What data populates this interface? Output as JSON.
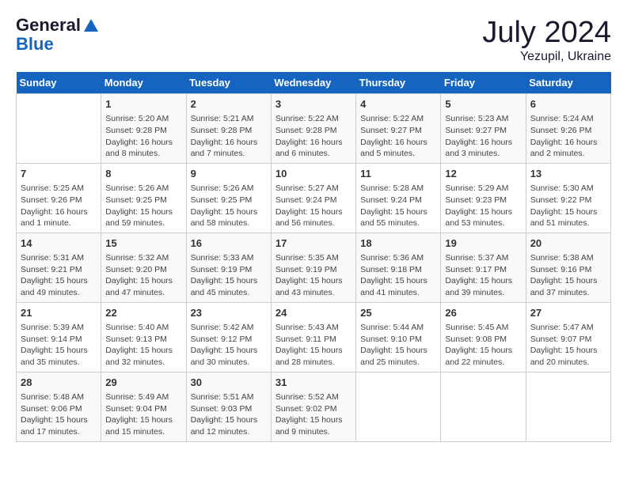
{
  "header": {
    "logo_line1": "General",
    "logo_line2": "Blue",
    "month": "July 2024",
    "location": "Yezupil, Ukraine"
  },
  "weekdays": [
    "Sunday",
    "Monday",
    "Tuesday",
    "Wednesday",
    "Thursday",
    "Friday",
    "Saturday"
  ],
  "weeks": [
    [
      {
        "day": "",
        "info": ""
      },
      {
        "day": "1",
        "info": "Sunrise: 5:20 AM\nSunset: 9:28 PM\nDaylight: 16 hours\nand 8 minutes."
      },
      {
        "day": "2",
        "info": "Sunrise: 5:21 AM\nSunset: 9:28 PM\nDaylight: 16 hours\nand 7 minutes."
      },
      {
        "day": "3",
        "info": "Sunrise: 5:22 AM\nSunset: 9:28 PM\nDaylight: 16 hours\nand 6 minutes."
      },
      {
        "day": "4",
        "info": "Sunrise: 5:22 AM\nSunset: 9:27 PM\nDaylight: 16 hours\nand 5 minutes."
      },
      {
        "day": "5",
        "info": "Sunrise: 5:23 AM\nSunset: 9:27 PM\nDaylight: 16 hours\nand 3 minutes."
      },
      {
        "day": "6",
        "info": "Sunrise: 5:24 AM\nSunset: 9:26 PM\nDaylight: 16 hours\nand 2 minutes."
      }
    ],
    [
      {
        "day": "7",
        "info": "Sunrise: 5:25 AM\nSunset: 9:26 PM\nDaylight: 16 hours\nand 1 minute."
      },
      {
        "day": "8",
        "info": "Sunrise: 5:26 AM\nSunset: 9:25 PM\nDaylight: 15 hours\nand 59 minutes."
      },
      {
        "day": "9",
        "info": "Sunrise: 5:26 AM\nSunset: 9:25 PM\nDaylight: 15 hours\nand 58 minutes."
      },
      {
        "day": "10",
        "info": "Sunrise: 5:27 AM\nSunset: 9:24 PM\nDaylight: 15 hours\nand 56 minutes."
      },
      {
        "day": "11",
        "info": "Sunrise: 5:28 AM\nSunset: 9:24 PM\nDaylight: 15 hours\nand 55 minutes."
      },
      {
        "day": "12",
        "info": "Sunrise: 5:29 AM\nSunset: 9:23 PM\nDaylight: 15 hours\nand 53 minutes."
      },
      {
        "day": "13",
        "info": "Sunrise: 5:30 AM\nSunset: 9:22 PM\nDaylight: 15 hours\nand 51 minutes."
      }
    ],
    [
      {
        "day": "14",
        "info": "Sunrise: 5:31 AM\nSunset: 9:21 PM\nDaylight: 15 hours\nand 49 minutes."
      },
      {
        "day": "15",
        "info": "Sunrise: 5:32 AM\nSunset: 9:20 PM\nDaylight: 15 hours\nand 47 minutes."
      },
      {
        "day": "16",
        "info": "Sunrise: 5:33 AM\nSunset: 9:19 PM\nDaylight: 15 hours\nand 45 minutes."
      },
      {
        "day": "17",
        "info": "Sunrise: 5:35 AM\nSunset: 9:19 PM\nDaylight: 15 hours\nand 43 minutes."
      },
      {
        "day": "18",
        "info": "Sunrise: 5:36 AM\nSunset: 9:18 PM\nDaylight: 15 hours\nand 41 minutes."
      },
      {
        "day": "19",
        "info": "Sunrise: 5:37 AM\nSunset: 9:17 PM\nDaylight: 15 hours\nand 39 minutes."
      },
      {
        "day": "20",
        "info": "Sunrise: 5:38 AM\nSunset: 9:16 PM\nDaylight: 15 hours\nand 37 minutes."
      }
    ],
    [
      {
        "day": "21",
        "info": "Sunrise: 5:39 AM\nSunset: 9:14 PM\nDaylight: 15 hours\nand 35 minutes."
      },
      {
        "day": "22",
        "info": "Sunrise: 5:40 AM\nSunset: 9:13 PM\nDaylight: 15 hours\nand 32 minutes."
      },
      {
        "day": "23",
        "info": "Sunrise: 5:42 AM\nSunset: 9:12 PM\nDaylight: 15 hours\nand 30 minutes."
      },
      {
        "day": "24",
        "info": "Sunrise: 5:43 AM\nSunset: 9:11 PM\nDaylight: 15 hours\nand 28 minutes."
      },
      {
        "day": "25",
        "info": "Sunrise: 5:44 AM\nSunset: 9:10 PM\nDaylight: 15 hours\nand 25 minutes."
      },
      {
        "day": "26",
        "info": "Sunrise: 5:45 AM\nSunset: 9:08 PM\nDaylight: 15 hours\nand 22 minutes."
      },
      {
        "day": "27",
        "info": "Sunrise: 5:47 AM\nSunset: 9:07 PM\nDaylight: 15 hours\nand 20 minutes."
      }
    ],
    [
      {
        "day": "28",
        "info": "Sunrise: 5:48 AM\nSunset: 9:06 PM\nDaylight: 15 hours\nand 17 minutes."
      },
      {
        "day": "29",
        "info": "Sunrise: 5:49 AM\nSunset: 9:04 PM\nDaylight: 15 hours\nand 15 minutes."
      },
      {
        "day": "30",
        "info": "Sunrise: 5:51 AM\nSunset: 9:03 PM\nDaylight: 15 hours\nand 12 minutes."
      },
      {
        "day": "31",
        "info": "Sunrise: 5:52 AM\nSunset: 9:02 PM\nDaylight: 15 hours\nand 9 minutes."
      },
      {
        "day": "",
        "info": ""
      },
      {
        "day": "",
        "info": ""
      },
      {
        "day": "",
        "info": ""
      }
    ]
  ]
}
